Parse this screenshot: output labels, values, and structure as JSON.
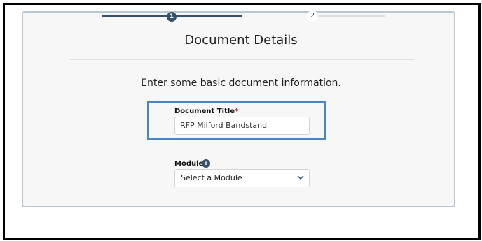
{
  "stepper": {
    "step1_number": "1",
    "step2_number": "2"
  },
  "card": {
    "title": "Document Details",
    "subtitle": "Enter some basic document information."
  },
  "fields": {
    "document_title": {
      "label": "Document Title",
      "required_marker": "*",
      "value": "RFP Milford Bandstand"
    },
    "modules": {
      "label": "Modules",
      "info_icon": "i",
      "selected": "Select a Module"
    }
  },
  "colors": {
    "accent": "#34516b",
    "highlight_border": "#4a86c5",
    "required": "#d0242b"
  }
}
